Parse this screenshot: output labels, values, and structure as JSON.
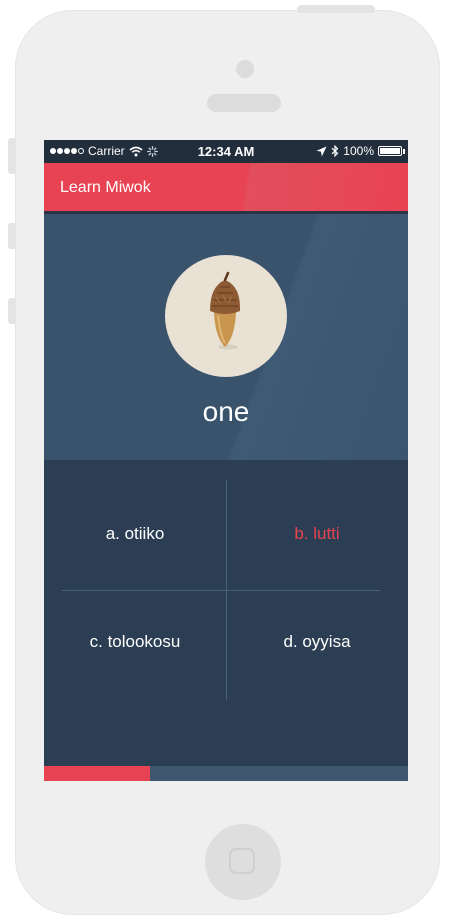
{
  "status_bar": {
    "carrier": "Carrier",
    "time": "12:34 AM",
    "battery": "100%",
    "signal_dots": 5,
    "signal_filled": 4
  },
  "app_bar": {
    "title": "Learn Miwok"
  },
  "question": {
    "image_icon": "acorn-icon",
    "word": "one"
  },
  "answers": [
    {
      "label": "a. otiiko",
      "color": "#ffffff"
    },
    {
      "label": "b. lutti",
      "color": "#e84352"
    },
    {
      "label": "c. tolookosu",
      "color": "#ffffff"
    },
    {
      "label": "d. oyyisa",
      "color": "#ffffff"
    }
  ],
  "progress": {
    "fraction": 0.29
  },
  "colors": {
    "accent": "#e84352",
    "question_bg": "#3a536c",
    "answers_bg": "#2b3e53",
    "status_bar": "#222e3c"
  }
}
